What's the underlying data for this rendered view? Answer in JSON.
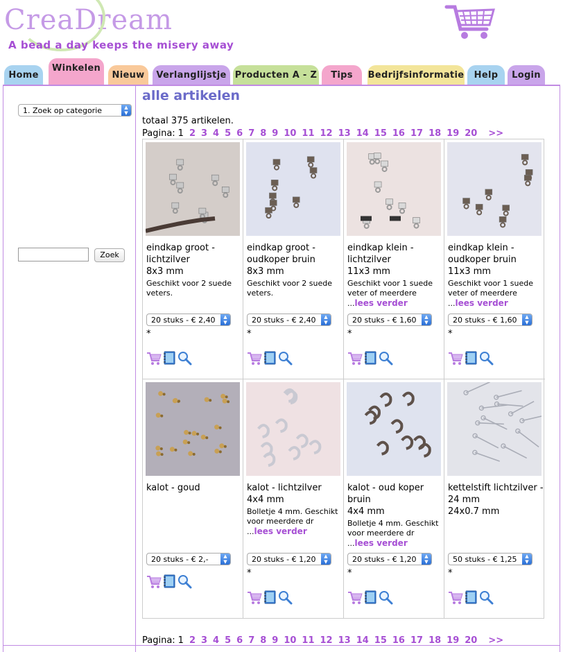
{
  "site": {
    "logo": "CreaDream",
    "slogan": "A bead a day keeps the misery away"
  },
  "tabs": [
    {
      "label": "Home",
      "color": "#a8d3f0"
    },
    {
      "label": "Winkelen",
      "color": "#f4a6cc"
    },
    {
      "label": "Nieuw",
      "color": "#f9c99a"
    },
    {
      "label": "Verlanglijstje",
      "color": "#c9a5ea"
    },
    {
      "label": "Producten A - Z",
      "color": "#c6e09a"
    },
    {
      "label": "Tips",
      "color": "#f4a6cc"
    },
    {
      "label": "Bedrijfsinformatie",
      "color": "#f3e59a"
    },
    {
      "label": "Help",
      "color": "#a8d3f0"
    },
    {
      "label": "Login",
      "color": "#c9a5ea"
    }
  ],
  "sidebar": {
    "category_select": "1. Zoek op categorie",
    "search_button": "Zoek"
  },
  "main": {
    "title": "alle artikelen",
    "total": "totaal 375 artikelen.",
    "pager_label": "Pagina:",
    "pages": [
      "1",
      "2",
      "3",
      "4",
      "5",
      "6",
      "7",
      "8",
      "9",
      "10",
      "11",
      "12",
      "13",
      "14",
      "15",
      "16",
      "17",
      "18",
      "19",
      "20",
      ">>"
    ]
  },
  "products": [
    {
      "title": "eindkap groot - lichtzilver",
      "size": "8x3 mm",
      "desc": "Geschikt voor 2 suede veters.",
      "more": "",
      "option": "20 stuks - € 2,40",
      "star": "*"
    },
    {
      "title": "eindkap groot - oudkoper bruin",
      "size": "8x3 mm",
      "desc": "Geschikt voor 2 suede veters.",
      "more": "",
      "option": "20 stuks - € 2,40",
      "star": "*"
    },
    {
      "title": "eindkap klein - lichtzilver",
      "size": "11x3 mm",
      "desc": "Geschikt voor 1 suede veter of meerdere ...",
      "more": "lees verder",
      "option": "20 stuks - € 1,60",
      "star": "*"
    },
    {
      "title": "eindkap klein - oudkoper bruin",
      "size": "11x3 mm",
      "desc": "Geschikt voor 1 suede veter of meerdere ...",
      "more": "lees verder",
      "option": "20 stuks - € 1,60",
      "star": "*"
    },
    {
      "title": "kalot - goud",
      "size": "",
      "desc": "",
      "more": "",
      "option": "20 stuks - € 2,-",
      "star": ""
    },
    {
      "title": "kalot - lichtzilver",
      "size": "4x4 mm",
      "desc": "Bolletje 4 mm. Geschikt voor meerdere dr ...",
      "more": "lees verder",
      "option": "20 stuks - € 1,20",
      "star": "*"
    },
    {
      "title": "kalot - oud koper bruin",
      "size": "4x4 mm",
      "desc": "Bolletje 4 mm. Geschikt voor meerdere dr ...",
      "more": "lees verder",
      "option": "20 stuks - € 1,20",
      "star": "*"
    },
    {
      "title": "kettelstift lichtzilver - 24 mm",
      "size": "24x0.7 mm",
      "desc": "",
      "more": "",
      "option": "50 stuks - € 1,25",
      "star": "*"
    }
  ],
  "icons": [
    "cart-icon",
    "notebook-icon",
    "magnifier-icon"
  ],
  "colors": {
    "accent": "#a64fd4",
    "title": "#6b6bc9",
    "border": "#c18be3"
  }
}
